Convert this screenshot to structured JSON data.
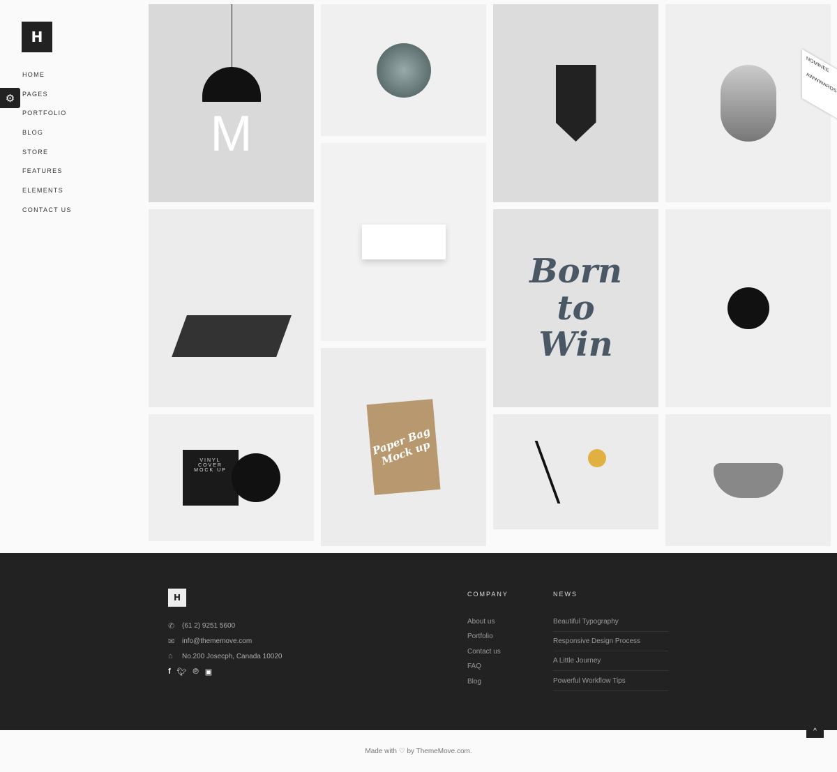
{
  "sidebar": {
    "logo": "H",
    "nav": [
      "HOME",
      "PAGES",
      "PORTFOLIO",
      "BLOG",
      "STORE",
      "FEATURES",
      "ELEMENTS",
      "CONTACT US"
    ]
  },
  "portfolio": {
    "items": [
      {
        "name": "pendant-lamp",
        "bg": "#d9d9d9",
        "label": "M"
      },
      {
        "name": "vases",
        "bg": "#ececec",
        "label": ""
      },
      {
        "name": "vinyl-cover",
        "bg": "#efefef",
        "label": "VINYL COVER MOCK UP"
      },
      {
        "name": "succulent",
        "bg": "#f0f0f0",
        "label": ""
      },
      {
        "name": "sofa",
        "bg": "#f2f2f2",
        "label": ""
      },
      {
        "name": "paper-bag",
        "bg": "#ececec",
        "label": "Paper Bag Mock up"
      },
      {
        "name": "pennant",
        "bg": "#dcdcdc",
        "label": ""
      },
      {
        "name": "born-to-win",
        "bg": "#e2e2e2",
        "label": "Born to Win"
      },
      {
        "name": "desk-lamp",
        "bg": "#ebebeb",
        "label": ""
      },
      {
        "name": "face",
        "bg": "#efefef",
        "label": ""
      },
      {
        "name": "apple-hands",
        "bg": "#efefef",
        "label": ""
      },
      {
        "name": "chair",
        "bg": "#eeeeee",
        "label": ""
      }
    ]
  },
  "award": {
    "line1": "NOMINEE",
    "line2": "AWWWARDS"
  },
  "footer": {
    "logo": "H",
    "phone": "(61 2) 9251 5600",
    "email": "info@thememove.com",
    "address": "No.200 Josecph, Canada 10020",
    "company_title": "COMPANY",
    "company_links": [
      "About us",
      "Portfolio",
      "Contact us",
      "FAQ",
      "Blog"
    ],
    "news_title": "NEWS",
    "news_links": [
      "Beautiful Typography",
      "Responsive Design Process",
      "A Little Journey",
      "Powerful Workflow Tips"
    ]
  },
  "copyright": "Made with ♡ by ThemeMove.com."
}
